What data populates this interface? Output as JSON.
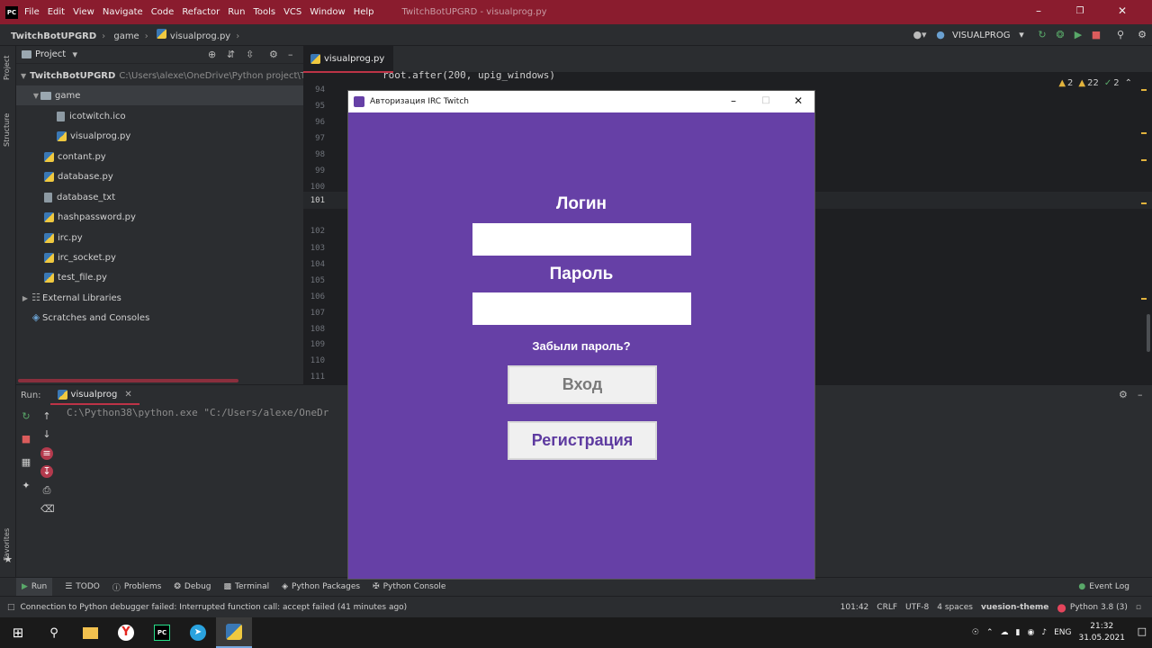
{
  "ide": {
    "window_title": "TwitchBotUPGRD - visualprog.py",
    "menu": [
      "File",
      "Edit",
      "View",
      "Navigate",
      "Code",
      "Refactor",
      "Run",
      "Tools",
      "VCS",
      "Window",
      "Help"
    ],
    "breadcrumb": {
      "project": "TwitchBotUPGRD",
      "folder": "game",
      "file": "visualprog.py"
    },
    "run_config": "VISUALPROG",
    "left_strip": {
      "project": "Project",
      "structure": "Structure",
      "favorites": "Favorites"
    },
    "project_panel": {
      "title": "Project",
      "root": {
        "name": "TwitchBotUPGRD",
        "path": "C:\\Users\\alexe\\OneDrive\\Python project\\Twitch"
      },
      "folder": "game",
      "folder_files": [
        "icotwitch.ico",
        "visualprog.py"
      ],
      "files": [
        "contant.py",
        "database.py",
        "database_txt",
        "hashpassword.py",
        "irc.py",
        "irc_socket.py",
        "test_file.py"
      ],
      "external": "External Libraries",
      "scratches": "Scratches and Consoles"
    },
    "editor": {
      "tab": "visualprog.py",
      "code_line": "root.after(200, upig_windows)",
      "line_numbers": [
        "94",
        "95",
        "96",
        "97",
        "98",
        "99",
        "100",
        "101",
        "102",
        "103",
        "104",
        "105",
        "106",
        "107",
        "108",
        "109",
        "110",
        "111"
      ],
      "inspections": {
        "warnings": "2",
        "weak": "22",
        "ok": "2"
      }
    },
    "run_panel": {
      "label": "Run:",
      "tab": "visualprog",
      "console": "C:\\Python38\\python.exe \"C:/Users/alexe/OneDr"
    },
    "bottom_tabs": [
      "Run",
      "TODO",
      "Problems",
      "Debug",
      "Terminal",
      "Python Packages",
      "Python Console"
    ],
    "event_log": "Event Log",
    "status": {
      "message": "Connection to Python debugger failed: Interrupted function call: accept failed (41 minutes ago)",
      "position": "101:42",
      "line_sep": "CRLF",
      "encoding": "UTF-8",
      "indent": "4 spaces",
      "theme": "vuesion-theme",
      "interpreter": "Python 3.8 (3)"
    }
  },
  "dialog": {
    "title": "Авторизация IRC Twitch",
    "login_label": "Логин",
    "login_value": "",
    "password_label": "Пароль",
    "password_value": "",
    "forgot": "Забыли пароль?",
    "login_button": "Вход",
    "register_button": "Регистрация",
    "bg_color": "#6640a6",
    "register_color": "#5e3ba0"
  },
  "taskbar": {
    "lang": "ENG",
    "time": "21:32",
    "date": "31.05.2021"
  }
}
